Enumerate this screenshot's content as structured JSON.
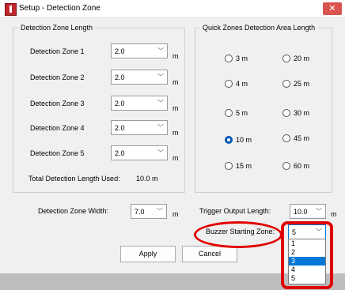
{
  "window": {
    "title": "Setup - Detection Zone",
    "close_glyph": "✕"
  },
  "length_group": {
    "legend": "Detection Zone Length",
    "zones": [
      {
        "label": "Detection Zone 1",
        "value": "2.0",
        "unit": "m"
      },
      {
        "label": "Detection Zone 2",
        "value": "2.0",
        "unit": "m"
      },
      {
        "label": "Detection Zone 3",
        "value": "2.0",
        "unit": "m"
      },
      {
        "label": "Detection Zone 4",
        "value": "2.0",
        "unit": "m"
      },
      {
        "label": "Detection Zone 5",
        "value": "2.0",
        "unit": "m"
      }
    ],
    "total_label": "Total Detection Length Used:",
    "total_value": "10.0 m"
  },
  "quick_group": {
    "legend": "Quick Zones Detection Area Length",
    "options": [
      {
        "label": "3 m",
        "checked": false
      },
      {
        "label": "20 m",
        "checked": false
      },
      {
        "label": "4 m",
        "checked": false
      },
      {
        "label": "25 m",
        "checked": false
      },
      {
        "label": "5 m",
        "checked": false
      },
      {
        "label": "30 m",
        "checked": false
      },
      {
        "label": "10 m",
        "checked": true
      },
      {
        "label": "45 m",
        "checked": false
      },
      {
        "label": "15 m",
        "checked": false
      },
      {
        "label": "60 m",
        "checked": false
      }
    ]
  },
  "width": {
    "label": "Detection Zone Width:",
    "value": "7.0",
    "unit": "m"
  },
  "trigger": {
    "label": "Trigger Output Length:",
    "value": "10.0",
    "unit": "m"
  },
  "buzzer": {
    "label": "Buzzer Starting Zone:",
    "value": "5",
    "options": [
      "1",
      "2",
      "3",
      "4",
      "5"
    ],
    "highlighted": "3"
  },
  "buttons": {
    "apply": "Apply",
    "cancel": "Cancel"
  },
  "icons": {
    "chevron": "chevron-down-icon",
    "close": "close-icon",
    "app": "app-icon"
  },
  "colors": {
    "accent": "#0078d7",
    "annotation": "#e00000",
    "radio_checked": "#0057b8"
  }
}
